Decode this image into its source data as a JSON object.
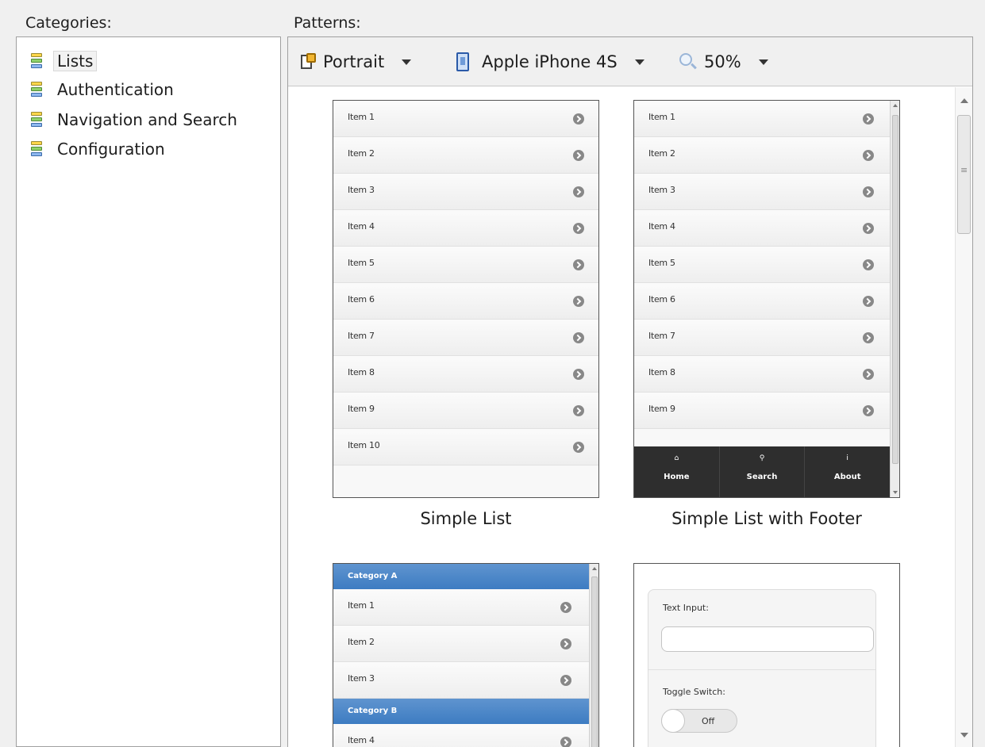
{
  "categories_label": "Categories:",
  "patterns_label": "Patterns:",
  "categories": [
    {
      "label": "Lists",
      "selected": true
    },
    {
      "label": "Authentication",
      "selected": false
    },
    {
      "label": "Navigation and Search",
      "selected": false
    },
    {
      "label": "Configuration",
      "selected": false
    }
  ],
  "toolbar": {
    "orientation": "Portrait",
    "device": "Apple iPhone 4S",
    "zoom": "50%"
  },
  "patterns": [
    {
      "caption": "Simple List",
      "items": [
        "Item 1",
        "Item 2",
        "Item 3",
        "Item 4",
        "Item 5",
        "Item 6",
        "Item 7",
        "Item 8",
        "Item 9",
        "Item 10"
      ]
    },
    {
      "caption": "Simple List with Footer",
      "items": [
        "Item 1",
        "Item 2",
        "Item 3",
        "Item 4",
        "Item 5",
        "Item 6",
        "Item 7",
        "Item 8",
        "Item 9"
      ],
      "footer": [
        {
          "icon": "home-icon",
          "glyph": "⌂",
          "label": "Home"
        },
        {
          "icon": "search-icon",
          "glyph": "⚲",
          "label": "Search"
        },
        {
          "icon": "info-icon",
          "glyph": "i",
          "label": "About"
        }
      ]
    },
    {
      "category_a": "Category A",
      "items_a": [
        "Item 1",
        "Item 2",
        "Item 3"
      ],
      "category_b": "Category B",
      "items_b": [
        "Item 4"
      ]
    },
    {
      "text_input_label": "Text Input:",
      "toggle_label": "Toggle Switch:",
      "toggle_value": "Off"
    }
  ],
  "colors": {
    "category_header": "#4a86c8",
    "footer_bg": "#2e2e2e"
  }
}
